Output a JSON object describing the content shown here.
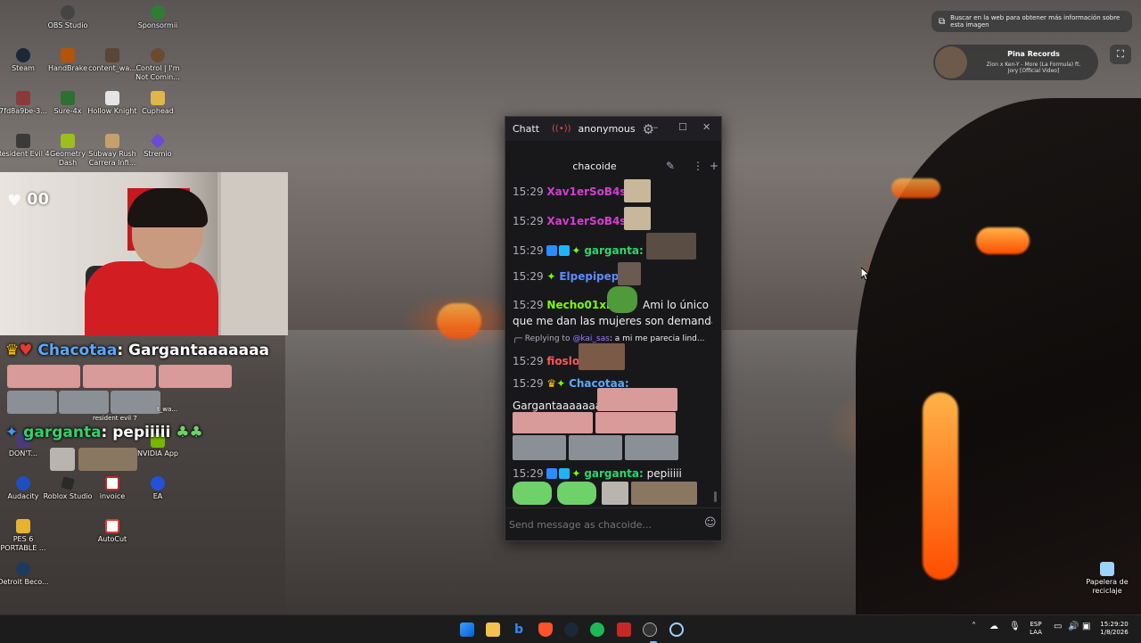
{
  "desktop_icons": [
    {
      "label": "OBS Studio",
      "color": "#444"
    },
    {
      "label": "Sponsormii",
      "color": "#2e7d32"
    },
    {
      "label": "Steam",
      "color": "#1b2838"
    },
    {
      "label": "HandBrake",
      "color": "#b45309"
    },
    {
      "label": "content_wa...",
      "color": "#5a4636"
    },
    {
      "label": "Control | I'm Not Comin...",
      "color": "#6b4a2f"
    },
    {
      "label": "7fd8a9be-3...",
      "color": "#8b3a3a"
    },
    {
      "label": "Sure-4x",
      "color": "#2f6f2f"
    },
    {
      "label": "Hollow Knight",
      "color": "#e5e5e5"
    },
    {
      "label": "Cuphead",
      "color": "#e0b64a"
    },
    {
      "label": "Resident Evil 4",
      "color": "#3a3a3a"
    },
    {
      "label": "Geometry Dash",
      "color": "#9bbf1f"
    },
    {
      "label": "Subway Rush Carrera Infi...",
      "color": "#c6a06a"
    },
    {
      "label": "Stremio",
      "color": "#6c4bd6"
    },
    {
      "label": "DON'T...",
      "color": "#4b3a7a"
    },
    {
      "label": "NVIDIA App",
      "color": "#76b900"
    },
    {
      "label": "Audacity",
      "color": "#1f4fbf"
    },
    {
      "label": "Roblox Studio",
      "color": "#2a2a2a"
    },
    {
      "label": "invoice",
      "color": "#c62828"
    },
    {
      "label": "EA",
      "color": "#2451d8"
    },
    {
      "label": "PES 6 PORTABLE ...",
      "color": "#e6b22f"
    },
    {
      "label": "AutoCut",
      "color": "#e53935"
    },
    {
      "label": "Detroit Beco...",
      "color": "#1e3a5f"
    },
    {
      "label": "Papelera de reciclaje",
      "color": "#9fd3ff"
    }
  ],
  "stream_overlay": {
    "like_counter": "00",
    "chat_line_1_user": "Chacotaa",
    "chat_line_1_text": ": Gargantaaaaaaa",
    "chat_line_1_user_color": "#5ba8ff",
    "chat_line_2_user": "garganta",
    "chat_line_2_text": ": pepiiiii",
    "chat_line_2_user_color": "#30d46c",
    "thumb_label_1": "resident evil 7",
    "thumb_label_2": "t_wa..."
  },
  "chat_window": {
    "app_name": "Chatt",
    "live_indicator": "((•))",
    "user": "anonymous",
    "settings_icon": "gear-icon",
    "minimize": "–",
    "maximize": "☐",
    "close": "✕",
    "channel_tab": "chacoide",
    "messages": [
      {
        "time": "15:29",
        "user": "Xav1erSoB4sed:",
        "color": "#d63cd6",
        "text": ""
      },
      {
        "time": "15:29",
        "user": "Xav1erSoB4sed:",
        "color": "#d63cd6",
        "text": ""
      },
      {
        "time": "15:29",
        "user": "garganta:",
        "color": "#30d46c",
        "text": ""
      },
      {
        "time": "15:29",
        "user": "Elpepipepi:",
        "color": "#5b8cff",
        "text": ""
      },
      {
        "time": "15:29",
        "user": "Necho01xD:",
        "color": "#7cfc00",
        "text": "Ami lo único",
        "text_2": "que me dan las mujeres son demandas"
      },
      {
        "reply": "Replying to",
        "reply_user": "@kai_sas",
        "reply_text": ": a mi me parecia lind..."
      },
      {
        "time": "15:29",
        "user": "fioslol:",
        "color": "#ff5555",
        "text": ""
      },
      {
        "time": "15:29",
        "user": "Chacotaa:",
        "color": "#5ba8ff",
        "text": "Gargantaaaaaaa"
      },
      {
        "time": "15:29",
        "user": "garganta:",
        "color": "#30d46c",
        "text": " pepiiiii"
      }
    ],
    "input_placeholder": "Send message as chacoide..."
  },
  "lens": {
    "search_hint": "Buscar en la web para obtener más información sobre esta imagen",
    "card_title": "Pina Records",
    "card_line_1": "Zion x Ken-Y - More (La Formula) ft.",
    "card_line_2": "Jory [Official Video]"
  },
  "taskbar": {
    "lang_top": "ESP",
    "lang_bottom": "LAA",
    "time": "15:29:20",
    "date": "1/8/2026"
  }
}
